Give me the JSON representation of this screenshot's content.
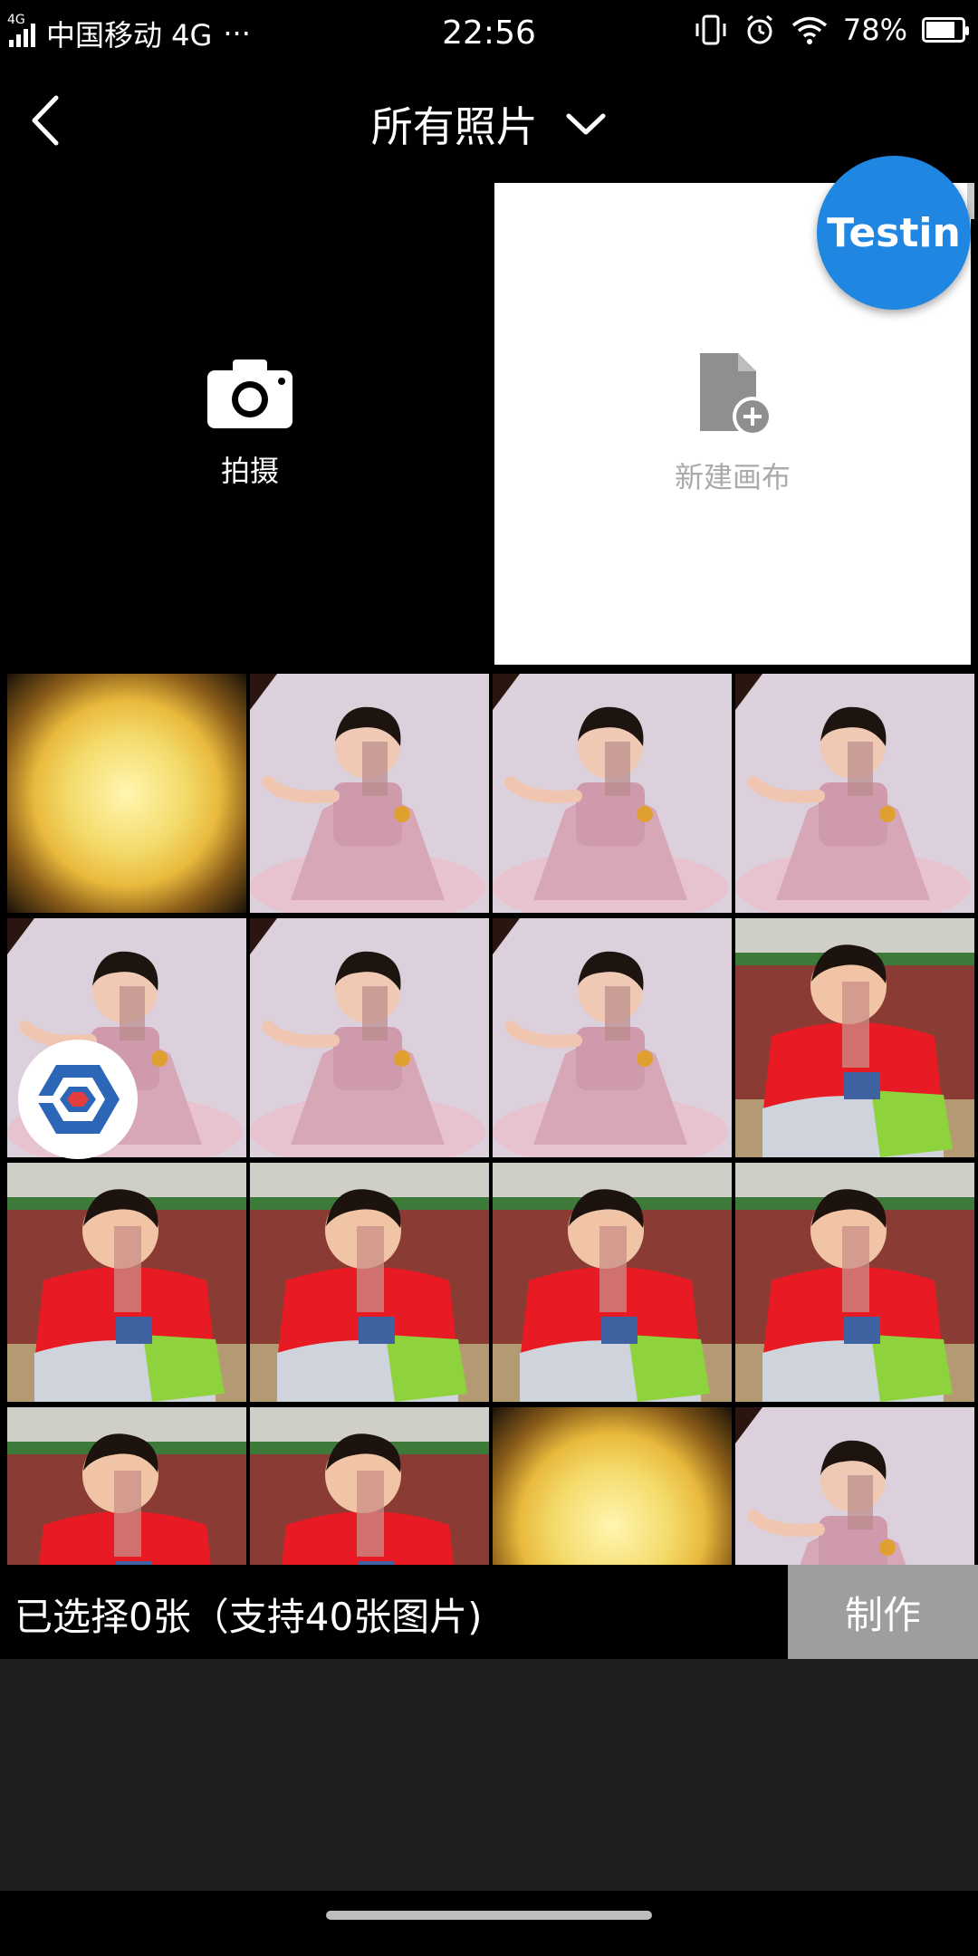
{
  "status_bar": {
    "network_label": "4G",
    "carrier": "中国移动 4G",
    "more": "···",
    "time": "22:56",
    "battery_percent": "78%",
    "battery_level": 0.78
  },
  "header": {
    "title": "所有照片"
  },
  "tiles": {
    "camera_label": "拍摄",
    "new_canvas_label": "新建画布"
  },
  "overlays": {
    "testin_label": "Testin"
  },
  "photos": [
    {
      "type": "blur"
    },
    {
      "type": "pink"
    },
    {
      "type": "pink"
    },
    {
      "type": "pink"
    },
    {
      "type": "pink"
    },
    {
      "type": "pink"
    },
    {
      "type": "pink"
    },
    {
      "type": "red"
    },
    {
      "type": "red"
    },
    {
      "type": "red"
    },
    {
      "type": "red"
    },
    {
      "type": "red"
    },
    {
      "type": "red"
    },
    {
      "type": "red"
    },
    {
      "type": "blur"
    },
    {
      "type": "pink"
    }
  ],
  "bottom_bar": {
    "selection_text": "已选择0张（支持40张图片)",
    "make_button": "制作"
  },
  "colors": {
    "accent_blue": "#1f86e2",
    "button_gray": "#9e9e9e"
  }
}
